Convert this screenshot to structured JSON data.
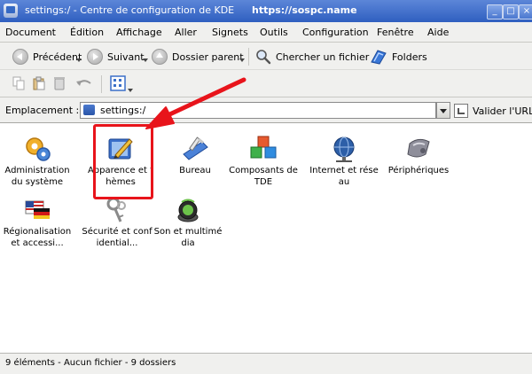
{
  "window": {
    "title": "settings:/ - Centre de configuration de KDE",
    "watermark": "https://sospc.name",
    "controls": {
      "minimize": "_",
      "maximize": "□",
      "close": "×"
    }
  },
  "menubar": {
    "items": [
      {
        "label": "Document"
      },
      {
        "label": "Édition"
      },
      {
        "label": "Affichage"
      },
      {
        "label": "Aller"
      },
      {
        "label": "Signets"
      },
      {
        "label": "Outils"
      },
      {
        "label": "Configuration"
      },
      {
        "label": "Fenêtre"
      },
      {
        "label": "Aide"
      }
    ]
  },
  "toolbar": {
    "back_label": "Précédent",
    "forward_label": "Suivant",
    "parent_label": "Dossier parent",
    "find_label": "Chercher un fichier",
    "folders_label": "Folders"
  },
  "location": {
    "label": "Emplacement :",
    "value": "settings:/",
    "go_label": "Valider l'URL"
  },
  "icons": [
    {
      "label": "Administration du système",
      "icon": "gears-icon"
    },
    {
      "label": "Apparence et thèmes",
      "icon": "appearance-pen-icon"
    },
    {
      "label": "Bureau",
      "icon": "desktop-icon"
    },
    {
      "label": "Composants de TDE",
      "icon": "components-cubes-icon"
    },
    {
      "label": "Internet et réseau",
      "icon": "globe-network-icon"
    },
    {
      "label": "Périphériques",
      "icon": "peripherals-icon"
    },
    {
      "label": "Régionalisation et accessi...",
      "icon": "flags-icon"
    },
    {
      "label": "Sécurité et confidential...",
      "icon": "keys-icon"
    },
    {
      "label": "Son et multimédia",
      "icon": "speaker-icon"
    }
  ],
  "statusbar": {
    "text": "9 éléments - Aucun fichier - 9 dossiers"
  },
  "colors": {
    "titlebar": "#2f5fc0",
    "highlight": "#e8141b"
  }
}
